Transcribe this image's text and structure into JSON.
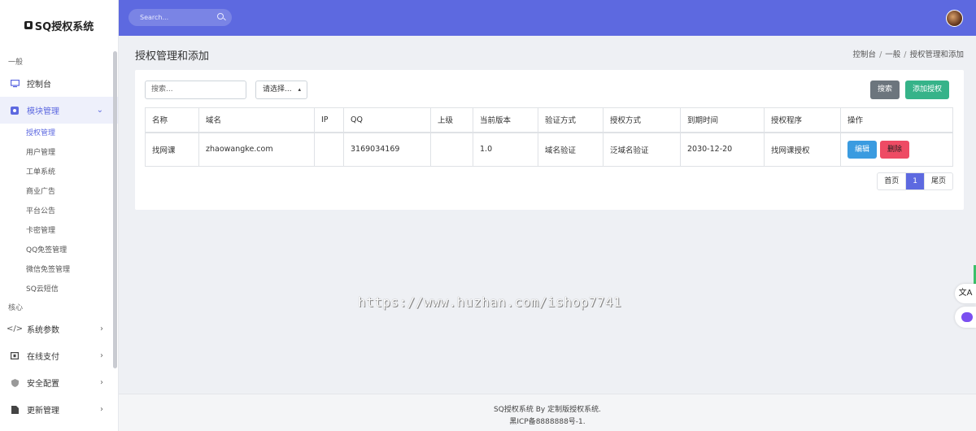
{
  "app": {
    "brand": "SQ授权系统"
  },
  "sidebar": {
    "section_general": "一般",
    "dashboard": "控制台",
    "module_mgmt": "模块管理",
    "sub_items": [
      "授权管理",
      "用户管理",
      "工单系统",
      "商业广告",
      "平台公告",
      "卡密管理",
      "QQ免签管理",
      "微信免签管理",
      "SQ云短信"
    ],
    "section_core": "核心",
    "core_items": [
      "系统参数",
      "在线支付",
      "安全配置",
      "更新管理"
    ]
  },
  "topbar": {
    "search_placeholder": "Search..."
  },
  "header": {
    "title": "授权管理和添加",
    "breadcrumb": [
      "控制台",
      "一般",
      "授权管理和添加"
    ]
  },
  "toolbar": {
    "keyword_placeholder": "搜索...",
    "select_label": "请选择...",
    "search_button": "搜索",
    "add_button": "添加授权"
  },
  "table": {
    "headers": [
      "名称",
      "域名",
      "IP",
      "QQ",
      "上级",
      "当前版本",
      "验证方式",
      "授权方式",
      "到期时间",
      "授权程序",
      "操作"
    ],
    "rows": [
      {
        "name": "找网课",
        "domain": "zhaowangke.com",
        "ip": "",
        "qq": "3169034169",
        "parent": "",
        "version": "1.0",
        "verify": "域名验证",
        "auth": "泛域名验证",
        "expire": "2030-12-20",
        "program": "找网课授权",
        "edit": "编辑",
        "delete": "删除"
      }
    ]
  },
  "pagination": {
    "first": "首页",
    "current": "1",
    "last": "尾页"
  },
  "watermark": "https://www.huzhan.com/ishop7741",
  "floats": {
    "translate": "文A"
  },
  "footer": {
    "line1": "SQ授权系统 By 定制版授权系统.",
    "line2": "黑ICP备8888888号-1."
  },
  "colors": {
    "primary": "#5d69e0",
    "success": "#36b389",
    "danger": "#ee4b64",
    "info": "#3a9be0",
    "secondary": "#6c757d"
  }
}
